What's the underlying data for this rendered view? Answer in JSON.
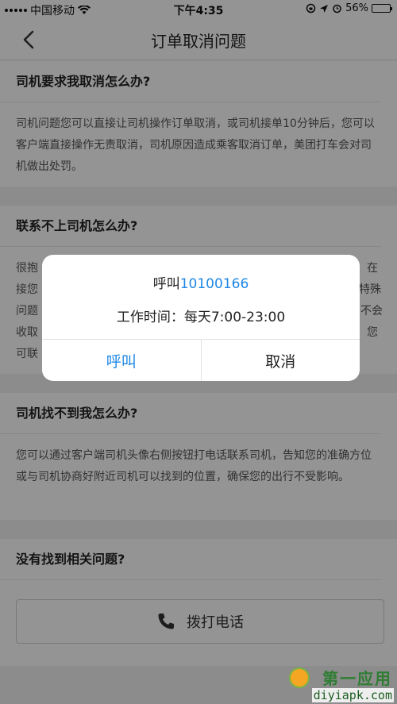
{
  "status_bar": {
    "carrier": "中国移动",
    "time": "下午4:35",
    "battery": "56%",
    "battery_level": 0.56
  },
  "navbar": {
    "title": "订单取消问题"
  },
  "faq": [
    {
      "question": "司机要求我取消怎么办?",
      "answer": "司机问题您可以直接让司机操作订单取消，或司机接单10分钟后，您可以客户端直接操作无责取消，司机原因造成乘客取消订单，美团打车会对司机做出处罚。"
    },
    {
      "question": "联系不上司机怎么办?",
      "answer_visible": [
        "很抱",
        "在",
        "接您",
        "特殊",
        "问题",
        "不会",
        "收取",
        "您",
        "可联"
      ]
    },
    {
      "question": "司机找不到我怎么办?",
      "answer": "您可以通过客户端司机头像右侧按钮打电话联系司机，告知您的准确方位或与司机协商好附近司机可以找到的位置，确保您的出行不受影响。"
    }
  ],
  "help": {
    "question": "没有找到相关问题?",
    "call_button": "拨打电话"
  },
  "dialog": {
    "call_prefix": "呼叫",
    "phone": "10100166",
    "work_hours": "工作时间：每天7:00-23:00",
    "call_label": "呼叫",
    "cancel_label": "取消"
  },
  "watermark": {
    "brand": "第一应用",
    "url": "diyiapk.com"
  }
}
